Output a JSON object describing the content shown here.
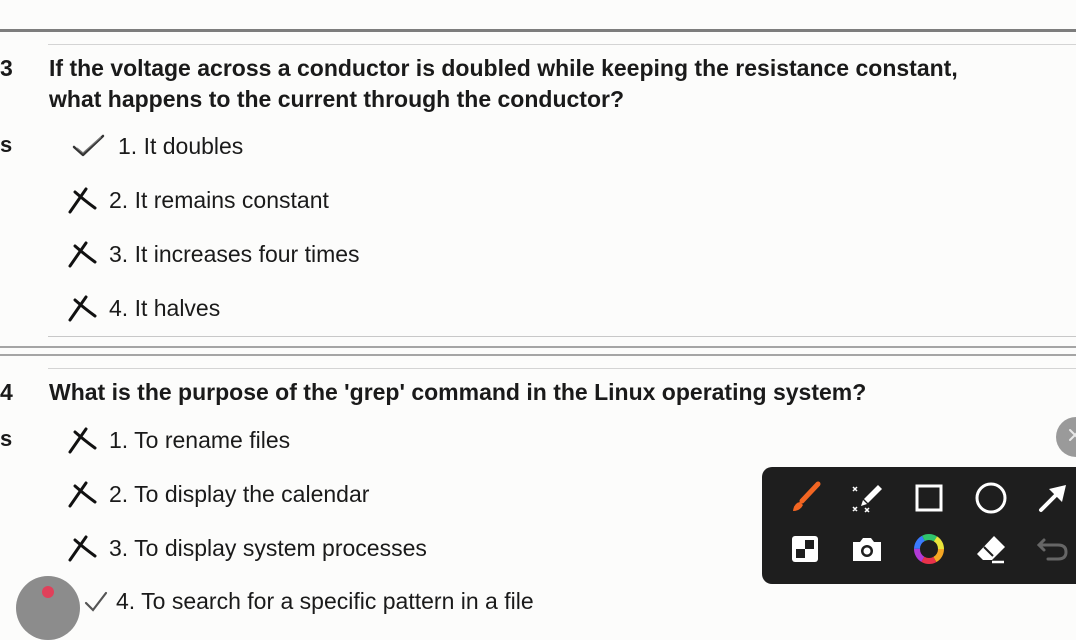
{
  "questions": [
    {
      "number": "3",
      "text_line1": "If the voltage across a conductor is doubled while keeping the resistance constant,",
      "text_line2": "what happens to the current through the conductor?",
      "side_label": "s",
      "options": [
        {
          "label": "1. It doubles",
          "status": "correct"
        },
        {
          "label": "2. It remains constant",
          "status": "wrong"
        },
        {
          "label": "3. It increases four times",
          "status": "wrong"
        },
        {
          "label": "4. It halves",
          "status": "wrong"
        }
      ]
    },
    {
      "number": "4",
      "text_line1": "What is the purpose of the 'grep' command in the Linux operating system?",
      "side_label": "s",
      "options": [
        {
          "label": "1. To rename files",
          "status": "wrong"
        },
        {
          "label": "2. To display the calendar",
          "status": "wrong"
        },
        {
          "label": "3. To display system processes",
          "status": "wrong"
        },
        {
          "label": "4. To search for a specific pattern in a file",
          "status": "correct"
        }
      ]
    }
  ],
  "annotation_toolbar": {
    "tools": [
      "brush-icon",
      "highlighter-icon",
      "rectangle-icon",
      "circle-icon",
      "arrow-icon",
      "mosaic-icon",
      "camera-icon",
      "color-picker-icon",
      "eraser-icon",
      "undo-icon"
    ],
    "active_color": "#f26522"
  },
  "colors": {
    "background": "#fcfcfb",
    "text": "#1a1a1a",
    "toolbar": "#1e1e1e"
  }
}
